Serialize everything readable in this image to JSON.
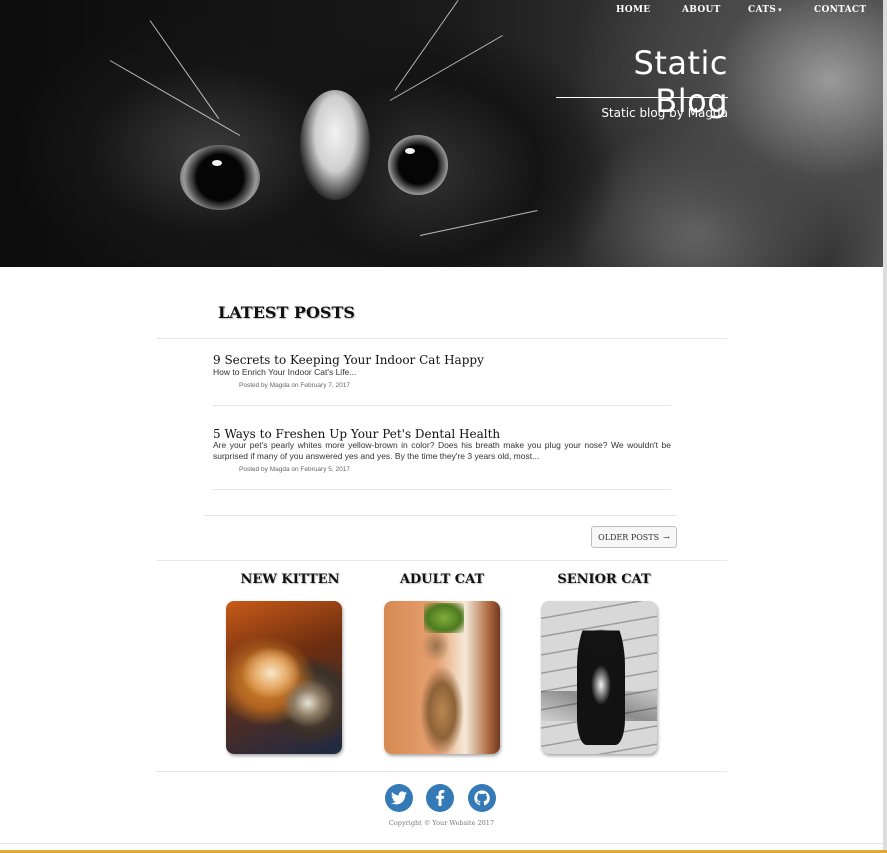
{
  "nav": {
    "items": [
      {
        "label": "HOME"
      },
      {
        "label": "ABOUT"
      },
      {
        "label": "CATS"
      },
      {
        "label": "CONTACT"
      }
    ]
  },
  "header": {
    "title": "Static Blog",
    "subtitle": "Static blog by Magda"
  },
  "main": {
    "section_title": "LATEST POSTS",
    "posts": [
      {
        "title": "9 Secrets to Keeping Your Indoor Cat Happy",
        "subtitle": "How to Enrich Your Indoor Cat's Life...",
        "meta": "Posted by Magda on February 7, 2017"
      },
      {
        "title": "5 Ways to Freshen Up Your Pet's Dental Health",
        "subtitle": "Are your pet's pearly whites more yellow-brown in color? Does his breath make you plug your nose? We wouldn't be surprised if many of you answered yes and yes. By the time they're 3 years old, most...",
        "meta": "Posted by Magda on February 5, 2017"
      }
    ],
    "older_label": "OLDER POSTS",
    "older_icon": "arrow-right-icon"
  },
  "categories": [
    {
      "label": "NEW KITTEN"
    },
    {
      "label": "ADULT CAT"
    },
    {
      "label": "SENIOR CAT"
    }
  ],
  "footer": {
    "social": [
      "twitter-icon",
      "facebook-icon",
      "github-icon"
    ],
    "copyright": "Copyright © Your Website 2017"
  },
  "colors": {
    "social_blue": "#337ab7",
    "bottom_accent": "#e0a83a"
  }
}
